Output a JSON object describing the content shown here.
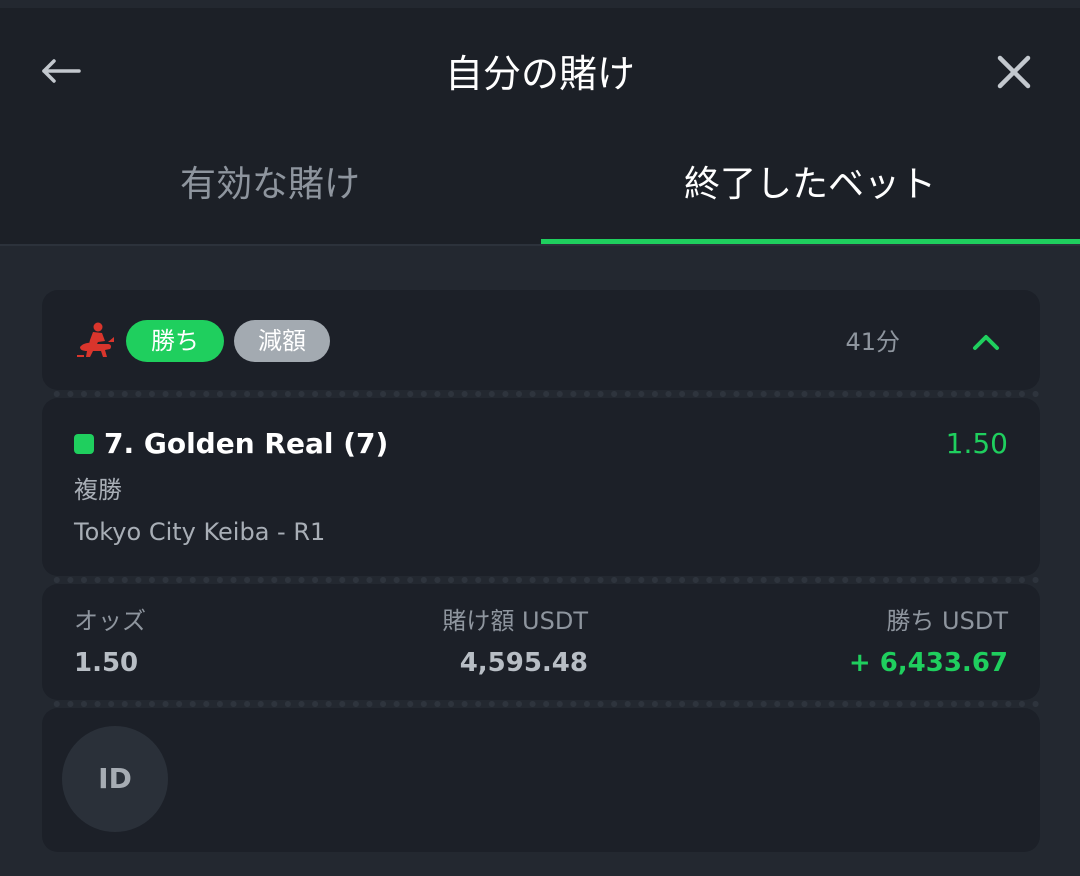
{
  "header": {
    "title": "自分の賭け",
    "back_icon": "arrow-left-icon",
    "close_icon": "close-icon"
  },
  "tabs": [
    {
      "label": "有効な賭け",
      "active": false
    },
    {
      "label": "終了したベット",
      "active": true
    }
  ],
  "bet": {
    "sport_icon": "horse-racing-icon",
    "status_badge": "勝ち",
    "reduction_badge": "減額",
    "time_ago": "41分",
    "selection": {
      "name": "7. Golden Real (7)",
      "odds": "1.50",
      "market": "複勝",
      "event": "Tokyo City Keiba - R1"
    },
    "stats": {
      "odds_label": "オッズ",
      "odds_value": "1.50",
      "stake_label": "賭け額 USDT",
      "stake_value": "4,595.48",
      "win_label": "勝ち USDT",
      "win_value": "+ 6,433.67"
    },
    "id_label": "ID"
  },
  "colors": {
    "accent_green": "#1fcf5e",
    "background": "#232830",
    "card": "#1c2028",
    "badge_grey": "#a3aab1",
    "icon_red": "#d9352c"
  }
}
